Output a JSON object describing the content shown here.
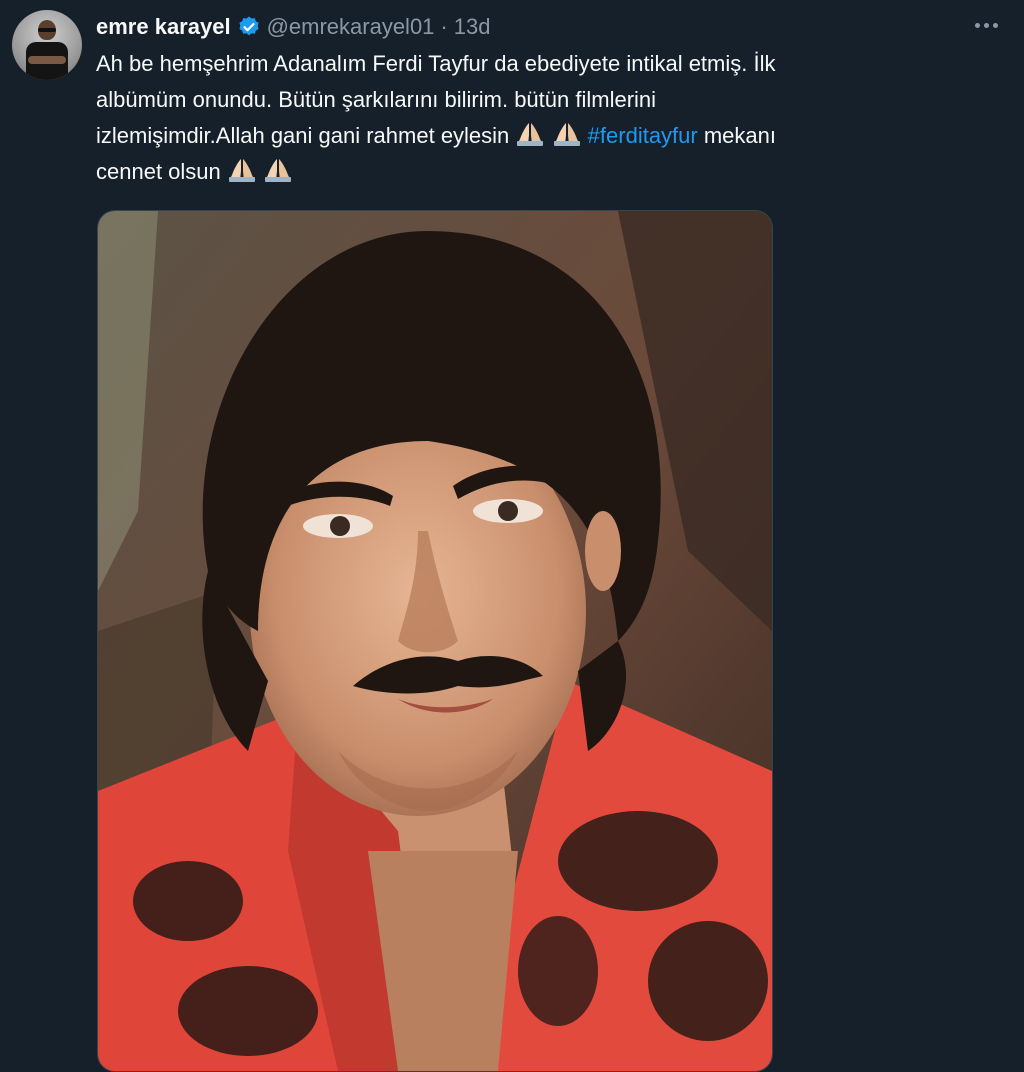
{
  "tweet": {
    "author": {
      "display_name": "emre karayel",
      "handle": "@emrekarayel01",
      "verified": true,
      "avatar_icon": "user-avatar"
    },
    "separator": "·",
    "time": "13d",
    "text_lines": [
      "Ah be hemşehrim Adanalım Ferdi Tayfur da ebediyete intikal etmiş. İlk",
      "albümüm onundu. Bütün şarkılarını bilirim. bütün filmlerini",
      "izlemişimdir.Allah gani gani rahmet eylesin",
      "mekanı",
      "cennet olsun"
    ],
    "hashtag": "#ferditayfur",
    "emoji": "folded-hands",
    "more_icon": "more-horizontal-icon"
  },
  "colors": {
    "background": "#15202b",
    "text": "#f7f9f9",
    "muted": "#8b98a5",
    "accent": "#1d9bf0"
  }
}
